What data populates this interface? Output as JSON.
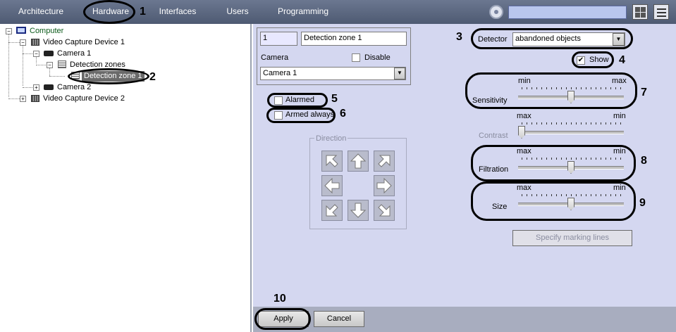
{
  "topbar": {
    "tabs": [
      {
        "label": "Architecture"
      },
      {
        "label": "Hardware"
      },
      {
        "label": "Interfaces"
      },
      {
        "label": "Users"
      },
      {
        "label": "Programming"
      }
    ],
    "search_value": ""
  },
  "tree": {
    "root": "Computer",
    "vcd1": "Video Capture Device 1",
    "camera1": "Camera 1",
    "detection_zones": "Detection zones",
    "detection_zone1": "Detection zone 1",
    "camera2": "Camera 2",
    "vcd2": "Video Capture Device 2"
  },
  "settings": {
    "id_value": "1",
    "name_value": "Detection zone 1",
    "camera_label": "Camera",
    "disable_label": "Disable",
    "camera_value": "Camera 1",
    "detector_label": "Detector",
    "detector_value": "abandoned objects",
    "show_label": "Show",
    "alarmed_label": "Alarmed",
    "armed_always_label": "Armed always",
    "direction_label": "Direction",
    "sensitivity": {
      "label": "Sensitivity",
      "left": "min",
      "right": "max",
      "level": 0.5
    },
    "contrast": {
      "label": "Contrast",
      "left": "max",
      "right": "min",
      "level": 0.0
    },
    "filtration": {
      "label": "Filtration",
      "left": "max",
      "right": "min",
      "level": 0.5
    },
    "size": {
      "label": "Size",
      "left": "max",
      "right": "min",
      "level": 0.5
    },
    "specify_button": "Specify marking lines",
    "apply_button": "Apply",
    "cancel_button": "Cancel"
  },
  "callouts": [
    "1",
    "2",
    "3",
    "4",
    "5",
    "6",
    "7",
    "8",
    "9",
    "10"
  ]
}
